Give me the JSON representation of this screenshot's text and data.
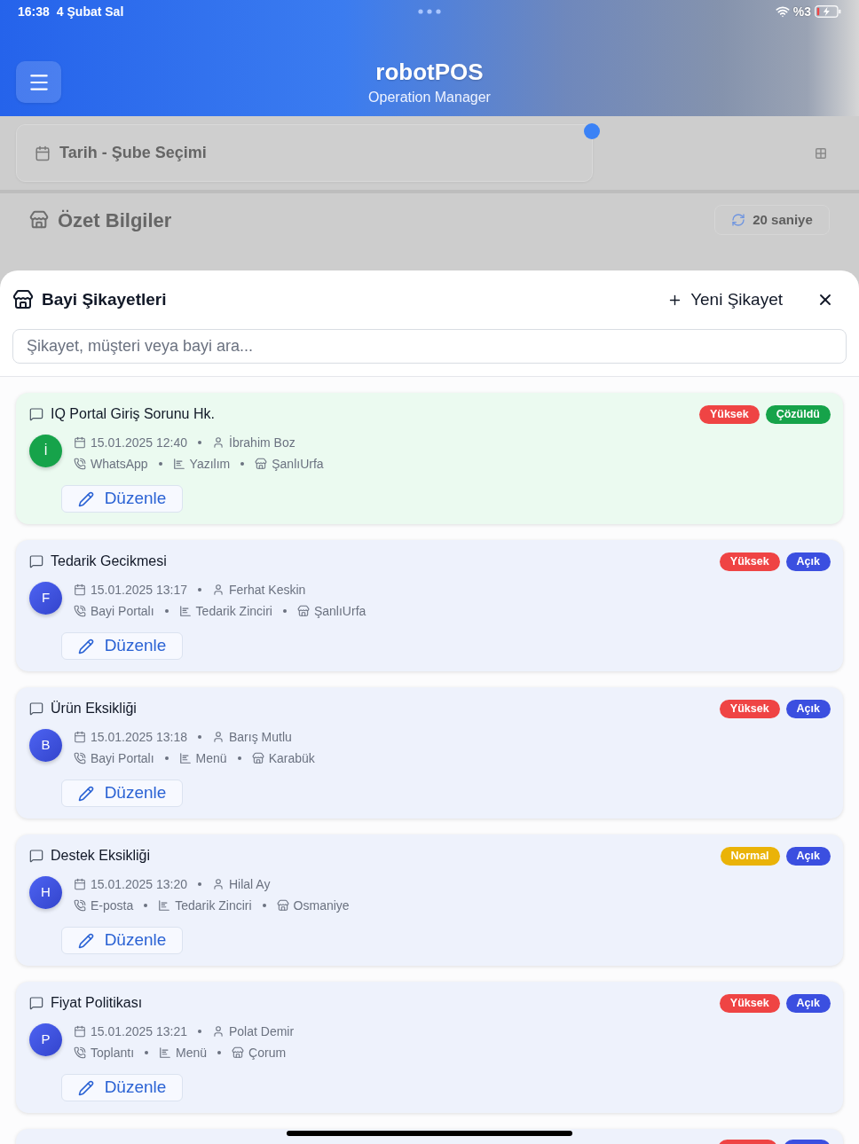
{
  "status_bar": {
    "time": "16:38",
    "date": "4 Şubat Sal",
    "battery": "%3"
  },
  "header": {
    "title": "robotPOS",
    "subtitle": "Operation Manager"
  },
  "background": {
    "filter_label": "Tarih - Şube Seçimi",
    "section_title": "Özet Bilgiler",
    "refresh_label": "20 saniye"
  },
  "sheet": {
    "title": "Bayi Şikayetleri",
    "new_button": "Yeni Şikayet",
    "search": {
      "placeholder": "Şikayet, müşteri veya bayi ara..."
    }
  },
  "complaints": [
    {
      "title": "IQ Portal Giriş Sorunu Hk.",
      "resolved": true,
      "badges": [
        {
          "label": "Yüksek",
          "color": "#ef4444"
        },
        {
          "label": "Çözüldü",
          "color": "#16a34a"
        }
      ],
      "avatar": "İ",
      "date": "15.01.2025 12:40",
      "person": "İbrahim Boz",
      "channel": "WhatsApp",
      "category": "Yazılım",
      "branch": "ŞanlıUrfa",
      "edit_button": "Düzenle"
    },
    {
      "title": "Tedarik Gecikmesi",
      "resolved": false,
      "badges": [
        {
          "label": "Yüksek",
          "color": "#ef4444"
        },
        {
          "label": "Açık",
          "color": "#3b4fe0"
        }
      ],
      "avatar": "F",
      "date": "15.01.2025 13:17",
      "person": "Ferhat Keskin",
      "channel": "Bayi Portalı",
      "category": "Tedarik Zinciri",
      "branch": "ŞanlıUrfa",
      "edit_button": "Düzenle"
    },
    {
      "title": "Ürün Eksikliği",
      "resolved": false,
      "badges": [
        {
          "label": "Yüksek",
          "color": "#ef4444"
        },
        {
          "label": "Açık",
          "color": "#3b4fe0"
        }
      ],
      "avatar": "B",
      "date": "15.01.2025 13:18",
      "person": "Barış Mutlu",
      "channel": "Bayi Portalı",
      "category": "Menü",
      "branch": "Karabük",
      "edit_button": "Düzenle"
    },
    {
      "title": "Destek Eksikliği",
      "resolved": false,
      "badges": [
        {
          "label": "Normal",
          "color": "#eab308"
        },
        {
          "label": "Açık",
          "color": "#3b4fe0"
        }
      ],
      "avatar": "H",
      "date": "15.01.2025 13:20",
      "person": "Hilal Ay",
      "channel": "E-posta",
      "category": "Tedarik Zinciri",
      "branch": "Osmaniye",
      "edit_button": "Düzenle"
    },
    {
      "title": "Fiyat Politikası",
      "resolved": false,
      "badges": [
        {
          "label": "Yüksek",
          "color": "#ef4444"
        },
        {
          "label": "Açık",
          "color": "#3b4fe0"
        }
      ],
      "avatar": "P",
      "date": "15.01.2025 13:21",
      "person": "Polat Demir",
      "channel": "Toplantı",
      "category": "Menü",
      "branch": "Çorum",
      "edit_button": "Düzenle"
    }
  ],
  "partial_card": {
    "badges": [
      {
        "color": "#ef4444"
      },
      {
        "color": "#3b4fe0"
      }
    ]
  }
}
